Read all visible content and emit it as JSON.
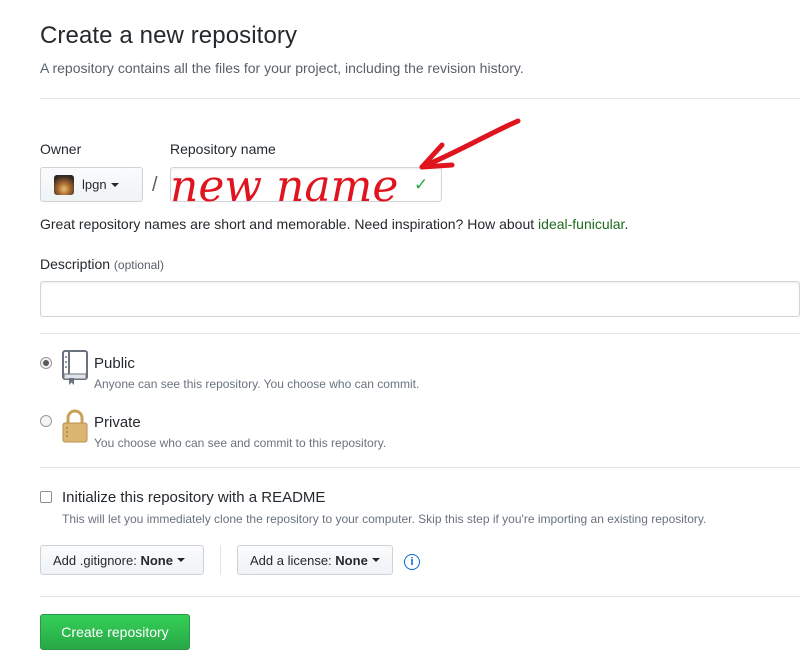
{
  "header": {
    "title": "Create a new repository",
    "subtitle": "A repository contains all the files for your project, including the revision history."
  },
  "owner": {
    "label": "Owner",
    "value": "lpgn"
  },
  "separator": "/",
  "repo_name": {
    "label": "Repository name",
    "handwritten_annotation": "new name",
    "valid_check": "✓"
  },
  "name_hint": {
    "prefix": "Great repository names are short and memorable. Need inspiration? How about ",
    "suggestion": "ideal-funicular",
    "suffix": "."
  },
  "description": {
    "label": "Description",
    "optional": "(optional)",
    "value": ""
  },
  "visibility": {
    "public": {
      "title": "Public",
      "desc": "Anyone can see this repository. You choose who can commit.",
      "checked": true
    },
    "private": {
      "title": "Private",
      "desc": "You choose who can see and commit to this repository.",
      "checked": false
    }
  },
  "init": {
    "title": "Initialize this repository with a README",
    "desc": "This will let you immediately clone the repository to your computer. Skip this step if you're importing an existing repository.",
    "checked": false
  },
  "gitignore": {
    "label": "Add .gitignore:",
    "value": "None"
  },
  "license": {
    "label": "Add a license:",
    "value": "None"
  },
  "info_icon": "i",
  "submit": {
    "label": "Create repository"
  },
  "colors": {
    "accent_green": "#28a745",
    "link_green": "#1e6a1e",
    "annotation_red": "#e0141e",
    "info_blue": "#0366d6"
  }
}
